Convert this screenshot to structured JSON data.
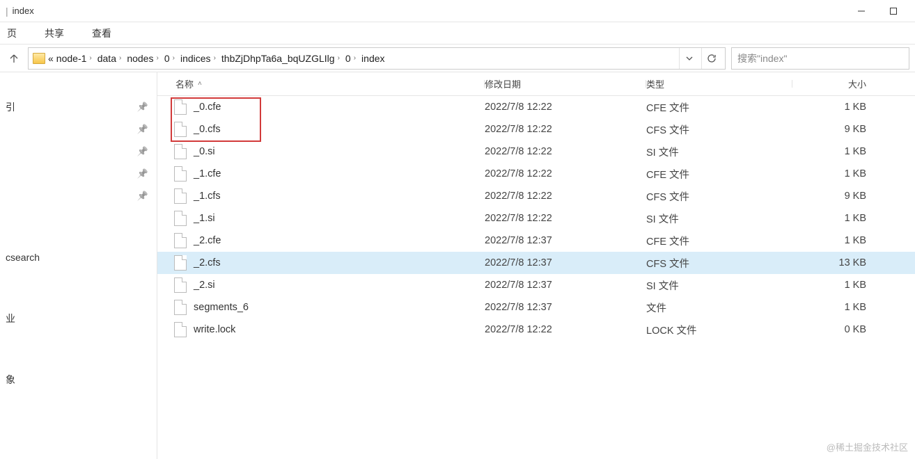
{
  "title": "index",
  "ribbon": {
    "tabs": [
      "页",
      "共享",
      "查看"
    ]
  },
  "breadcrumbs": [
    "node-1",
    "data",
    "nodes",
    "0",
    "indices",
    "thbZjDhpTa6a_bqUZGLIlg",
    "0",
    "index"
  ],
  "search": {
    "placeholder": "搜索\"index\""
  },
  "nav_items": [
    {
      "label": "引",
      "pin": true
    },
    {
      "label": "",
      "pin": true
    },
    {
      "label": "",
      "pin": true
    },
    {
      "label": "",
      "pin": true
    },
    {
      "label": "",
      "pin": true
    },
    {
      "label": "",
      "pin": false,
      "spacer_before": true
    },
    {
      "label": "csearch",
      "pin": false
    },
    {
      "label": "",
      "pin": false,
      "spacer_before": true
    },
    {
      "label": "业",
      "pin": false
    },
    {
      "label": "",
      "pin": false,
      "spacer_before": true
    },
    {
      "label": "象",
      "pin": false
    }
  ],
  "columns": {
    "name": "名称",
    "date": "修改日期",
    "type": "类型",
    "size": "大小"
  },
  "files": [
    {
      "name": "_0.cfe",
      "date": "2022/7/8 12:22",
      "type": "CFE 文件",
      "size": "1 KB"
    },
    {
      "name": "_0.cfs",
      "date": "2022/7/8 12:22",
      "type": "CFS 文件",
      "size": "9 KB"
    },
    {
      "name": "_0.si",
      "date": "2022/7/8 12:22",
      "type": "SI 文件",
      "size": "1 KB"
    },
    {
      "name": "_1.cfe",
      "date": "2022/7/8 12:22",
      "type": "CFE 文件",
      "size": "1 KB"
    },
    {
      "name": "_1.cfs",
      "date": "2022/7/8 12:22",
      "type": "CFS 文件",
      "size": "9 KB"
    },
    {
      "name": "_1.si",
      "date": "2022/7/8 12:22",
      "type": "SI 文件",
      "size": "1 KB"
    },
    {
      "name": "_2.cfe",
      "date": "2022/7/8 12:37",
      "type": "CFE 文件",
      "size": "1 KB"
    },
    {
      "name": "_2.cfs",
      "date": "2022/7/8 12:37",
      "type": "CFS 文件",
      "size": "13 KB",
      "selected": true
    },
    {
      "name": "_2.si",
      "date": "2022/7/8 12:37",
      "type": "SI 文件",
      "size": "1 KB"
    },
    {
      "name": "segments_6",
      "date": "2022/7/8 12:37",
      "type": "文件",
      "size": "1 KB"
    },
    {
      "name": "write.lock",
      "date": "2022/7/8 12:22",
      "type": "LOCK 文件",
      "size": "0 KB"
    }
  ],
  "highlight": {
    "start": 0,
    "end": 1
  },
  "watermark": "@稀土掘金技术社区"
}
